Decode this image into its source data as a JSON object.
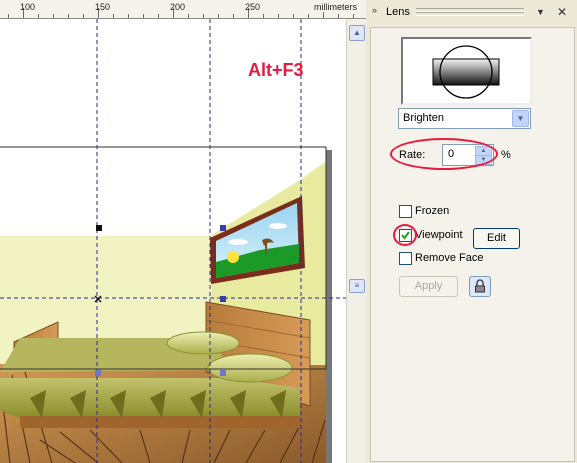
{
  "ruler": {
    "labels": [
      "100",
      "150",
      "200",
      "250"
    ],
    "unit": "millimeters"
  },
  "canvas": {
    "shortcut_text": "Alt+F3",
    "shortcut_color": "#e8193e"
  },
  "docker": {
    "title": "Lens",
    "lens_type": "Brighten",
    "rate_label": "Rate:",
    "rate_value": "0",
    "rate_unit": "%",
    "frozen_label": "Frozen",
    "frozen_checked": false,
    "viewpoint_label": "Viewpoint",
    "viewpoint_checked": true,
    "edit_label": "Edit",
    "remove_face_label": "Remove Face",
    "remove_face_checked": false,
    "apply_label": "Apply"
  },
  "colors": {
    "highlight": "#e8193e",
    "panel_bg": "#ece9d8",
    "guideline": "#2a2a8a"
  }
}
